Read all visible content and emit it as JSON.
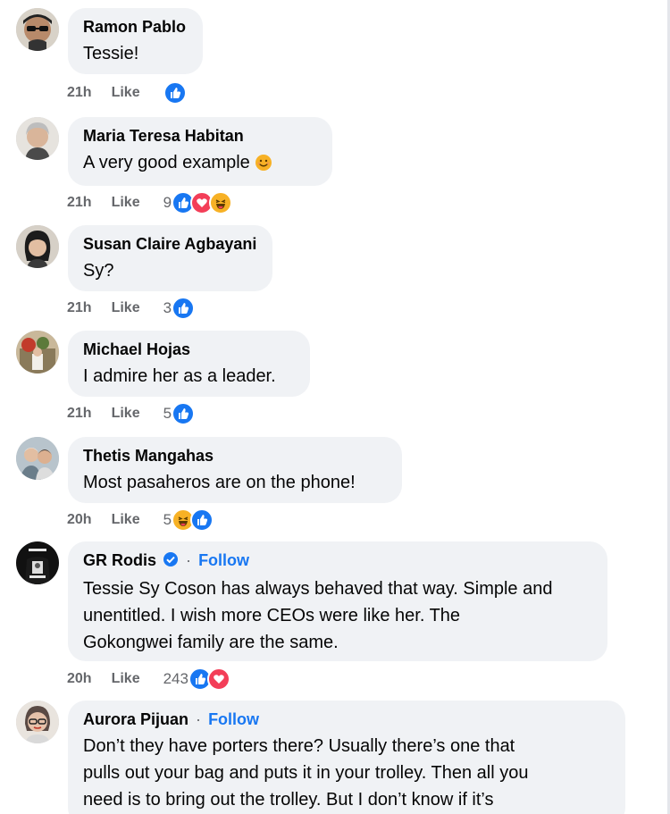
{
  "comments": [
    {
      "author": "Ramon Pablo",
      "text": "Tessie!",
      "time": "21h",
      "like_label": "Like",
      "count": "",
      "reactions": [
        "like"
      ]
    },
    {
      "author": "Maria Teresa Habitan",
      "text": "A very good example",
      "time": "21h",
      "like_label": "Like",
      "count": "9",
      "reactions": [
        "like",
        "love",
        "haha"
      ]
    },
    {
      "author": "Susan Claire Agbayani",
      "text": "Sy?",
      "time": "21h",
      "like_label": "Like",
      "count": "3",
      "reactions": [
        "like"
      ]
    },
    {
      "author": "Michael Hojas",
      "text": "I admire her as a leader.",
      "time": "21h",
      "like_label": "Like",
      "count": "5",
      "reactions": [
        "like"
      ]
    },
    {
      "author": "Thetis Mangahas",
      "text": "Most pasaheros are on the phone!",
      "time": "20h",
      "like_label": "Like",
      "count": "5",
      "reactions": [
        "haha",
        "like"
      ]
    },
    {
      "author": "GR Rodis",
      "follow": "Follow",
      "dot": "·",
      "text_lines": [
        "Tessie Sy Coson has always behaved that way. Simple and",
        "unentitled. I wish more CEOs were like her. The",
        "Gokongwei family are the same."
      ],
      "time": "20h",
      "like_label": "Like",
      "count": "243",
      "reactions": [
        "like",
        "love"
      ]
    },
    {
      "author": "Aurora Pijuan",
      "follow": "Follow",
      "dot": "·",
      "text_lines": [
        "Don’t they have porters there? Usually there’s one that",
        "pulls out your bag and puts it in your trolley. Then all you",
        "need is to bring out the trolley. But I don’t know if it’s"
      ]
    }
  ],
  "colors": {
    "accent": "#1877f2",
    "bubble": "#f0f2f5",
    "love": "#f33e58",
    "haha": "#f7b125"
  }
}
